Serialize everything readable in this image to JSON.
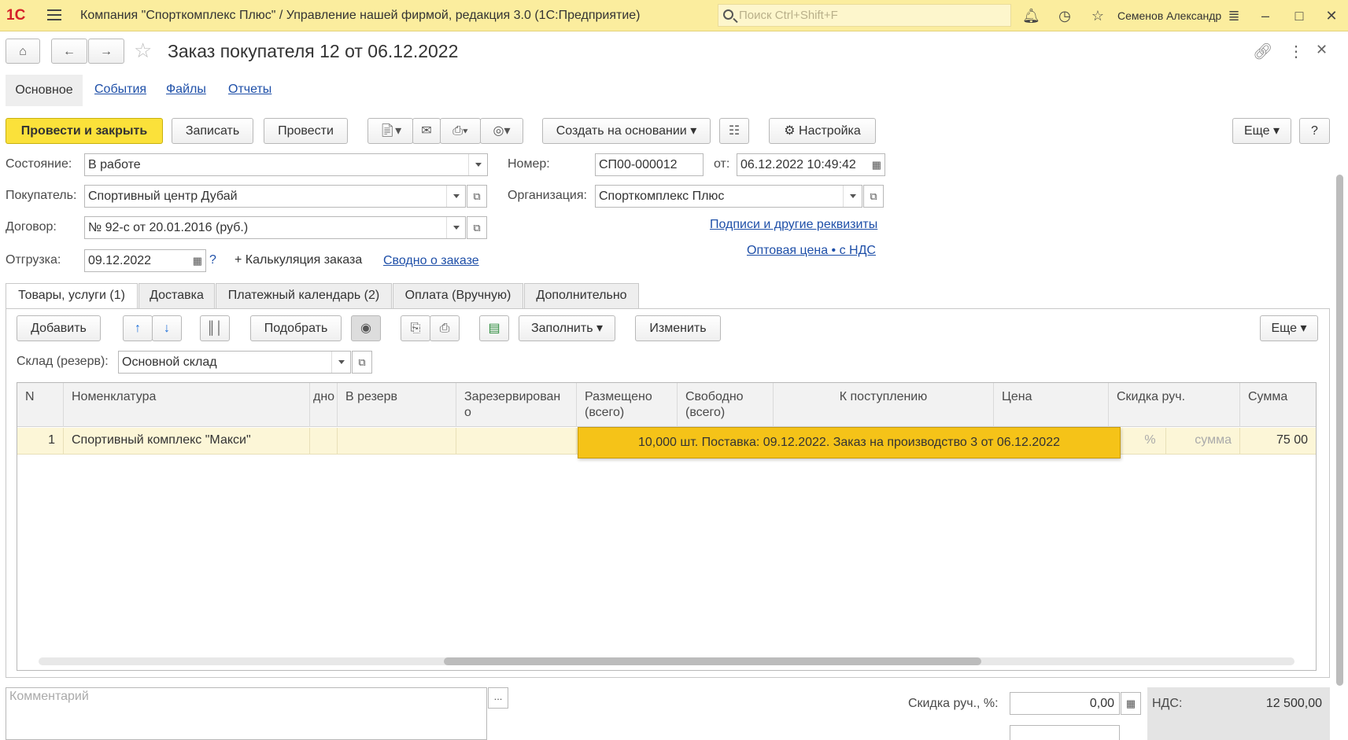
{
  "titlebar": {
    "app_title": "Компания \"Спорткомплекс Плюс\" / Управление нашей фирмой, редакция 3.0  (1С:Предприятие)",
    "search_placeholder": "Поиск Ctrl+Shift+F",
    "user": "Семенов Александр",
    "logo": "1С"
  },
  "doc": {
    "title": "Заказ покупателя 12 от 06.12.2022"
  },
  "nav_tabs": [
    "Основное",
    "События",
    "Файлы",
    "Отчеты"
  ],
  "toolbar": {
    "post_close": "Провести и закрыть",
    "save": "Записать",
    "post": "Провести",
    "create_based": "Создать на основании",
    "settings": "Настройка",
    "more": "Еще",
    "help": "?"
  },
  "form": {
    "state_label": "Состояние:",
    "state_value": "В работе",
    "buyer_label": "Покупатель:",
    "buyer_value": "Спортивный центр Дубай",
    "contract_label": "Договор:",
    "contract_value": "№ 92-с от 20.01.2016 (руб.)",
    "shipment_label": "Отгрузка:",
    "shipment_value": "09.12.2022",
    "shipment_q": "?",
    "calc_label": "+ Калькуляция заказа",
    "summary_link": "Сводно о заказе",
    "number_label": "Номер:",
    "number_value": "СП00-000012",
    "from_label": "от:",
    "from_value": "06.12.2022 10:49:42",
    "org_label": "Организация:",
    "org_value": "Спорткомплекс Плюс",
    "signatures_link": "Подписи и другие реквизиты",
    "price_link": "Оптовая цена • с НДС"
  },
  "tabs": [
    "Товары, услуги (1)",
    "Доставка",
    "Платежный календарь (2)",
    "Оплата (Вручную)",
    "Дополнительно"
  ],
  "table_toolbar": {
    "add": "Добавить",
    "pick": "Подобрать",
    "fill": "Заполнить",
    "change": "Изменить",
    "more": "Еще"
  },
  "warehouse": {
    "label": "Склад (резерв):",
    "value": "Основной склад"
  },
  "table": {
    "headers": [
      "N",
      "Номенклатура",
      "дно",
      "В резерв",
      "Зарезервирован о",
      "Размещено (всего)",
      "Свободно (всего)",
      "К поступлению",
      "Цена",
      "Скидка руч.",
      "Сумма"
    ],
    "rows": [
      {
        "n": "1",
        "name": "Спортивный комплекс \"Макси\"",
        "discount_pct": "%",
        "discount_sum": "сумма",
        "sum": "75 00"
      }
    ]
  },
  "tooltip": "10,000 шт. Поставка: 09.12.2022. Заказ на производство 3 от 06.12.2022",
  "footer": {
    "comment_placeholder": "Комментарий",
    "comment_btn": "...",
    "discount_label": "Скидка руч., %:",
    "discount_value": "0,00",
    "vat_label": "НДС:",
    "vat_value": "12 500,00"
  }
}
